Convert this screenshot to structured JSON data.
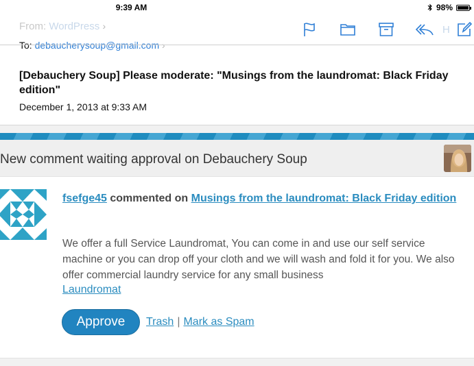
{
  "status_bar": {
    "time": "9:39 AM",
    "battery": "98%",
    "battery_level": 0.98
  },
  "header": {
    "from_label": "From:",
    "from_value": "WordPress",
    "to_label": "To:",
    "to_value": "debaucherysoup@gmail.com",
    "subject": "[Debauchery Soup] Please moderate: \"Musings from the laundromat: Black Friday edition\"",
    "date": "December 1, 2013 at 9:33 AM",
    "hide_label": "Hide"
  },
  "toolbar": {
    "icons": [
      "flag-icon",
      "folder-icon",
      "archive-icon",
      "reply-icon",
      "compose-icon"
    ]
  },
  "body": {
    "banner_text": "New comment waiting approval on Debauchery Soup",
    "commenter": "fsefge45",
    "commented_on": " commented on ",
    "post_title": "Musings from the laundromat: Black Friday edition",
    "comment_text": "We offer a full Service Laundromat, You can come in and use our self service machine or you can drop off your cloth and we will wash and fold it for you. We also offer commercial laundry service for any small business",
    "comment_link": "Laundromat",
    "actions": {
      "approve": "Approve",
      "trash": "Trash",
      "separator": "|",
      "spam": "Mark as Spam"
    }
  },
  "colors": {
    "accent": "#2f7fd6",
    "link": "#2a8cbf",
    "approve_bg": "#2184c0",
    "stripe_dark": "#1f8cbf",
    "stripe_light": "#45a6d3"
  }
}
